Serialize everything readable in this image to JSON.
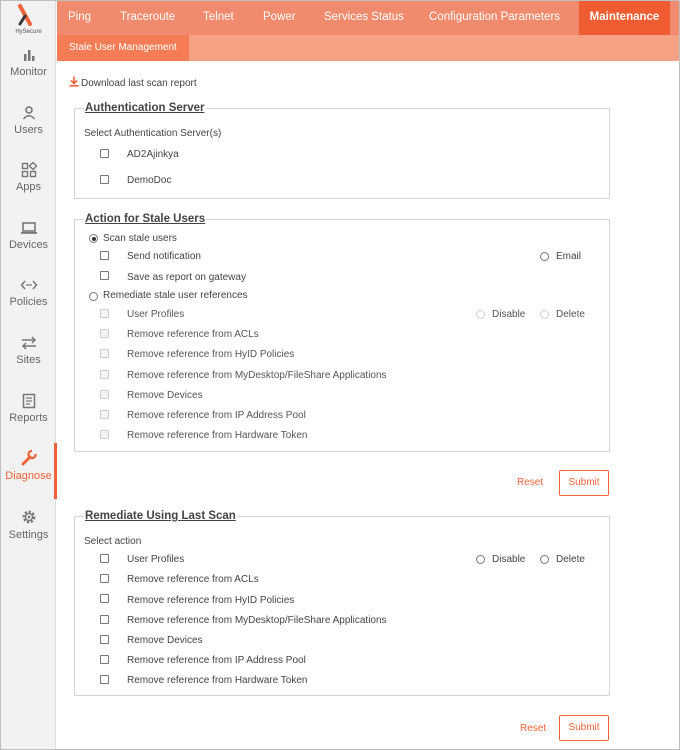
{
  "brand": {
    "name": "HySecure"
  },
  "sidebar": {
    "items": [
      {
        "label": "Monitor",
        "icon": "bar-chart-icon"
      },
      {
        "label": "Users",
        "icon": "user-icon"
      },
      {
        "label": "Apps",
        "icon": "apps-icon"
      },
      {
        "label": "Devices",
        "icon": "laptop-icon"
      },
      {
        "label": "Policies",
        "icon": "code-arrows-icon"
      },
      {
        "label": "Sites",
        "icon": "swap-arrows-icon"
      },
      {
        "label": "Reports",
        "icon": "report-icon"
      },
      {
        "label": "Diagnose",
        "icon": "wrench-icon",
        "active": true
      },
      {
        "label": "Settings",
        "icon": "gear-icon"
      }
    ]
  },
  "topnav": {
    "tabs": [
      {
        "label": "Ping"
      },
      {
        "label": "Traceroute"
      },
      {
        "label": "Telnet"
      },
      {
        "label": "Power"
      },
      {
        "label": "Services Status"
      },
      {
        "label": "Configuration Parameters"
      },
      {
        "label": "Maintenance",
        "active": true
      }
    ],
    "subtab": "Stale User Management"
  },
  "download_label": "Download last scan report",
  "auth_server": {
    "title": "Authentication Server",
    "prompt": "Select Authentication Server(s)",
    "servers": [
      "AD2Ajinkya",
      "DemoDoc"
    ]
  },
  "stale_action": {
    "title": "Action for Stale Users",
    "scan_label": "Scan stale users",
    "send_notification": "Send notification",
    "email": "Email",
    "save_report": "Save as report on gateway",
    "remediate_label": "Remediate stale user references",
    "user_profiles": "User Profiles",
    "disable": "Disable",
    "delete": "Delete",
    "items": [
      "Remove reference from ACLs",
      "Remove reference from HyID Policies",
      "Remove reference from MyDesktop/FileShare Applications",
      "Remove Devices",
      "Remove reference from IP Address Pool",
      "Remove reference from Hardware Token"
    ],
    "reset": "Reset",
    "submit": "Submit"
  },
  "last_scan": {
    "title": "Remediate Using Last Scan",
    "prompt": "Select action",
    "user_profiles": "User Profiles",
    "disable": "Disable",
    "delete": "Delete",
    "items": [
      "Remove reference from ACLs",
      "Remove reference from HyID Policies",
      "Remove reference from MyDesktop/FileShare Applications",
      "Remove Devices",
      "Remove reference from IP Address Pool",
      "Remove reference from Hardware Token"
    ],
    "reset": "Reset",
    "submit": "Submit"
  },
  "colors": {
    "accent": "#f0643c",
    "nav": "#f28b6d",
    "subnav": "#f5a183"
  }
}
